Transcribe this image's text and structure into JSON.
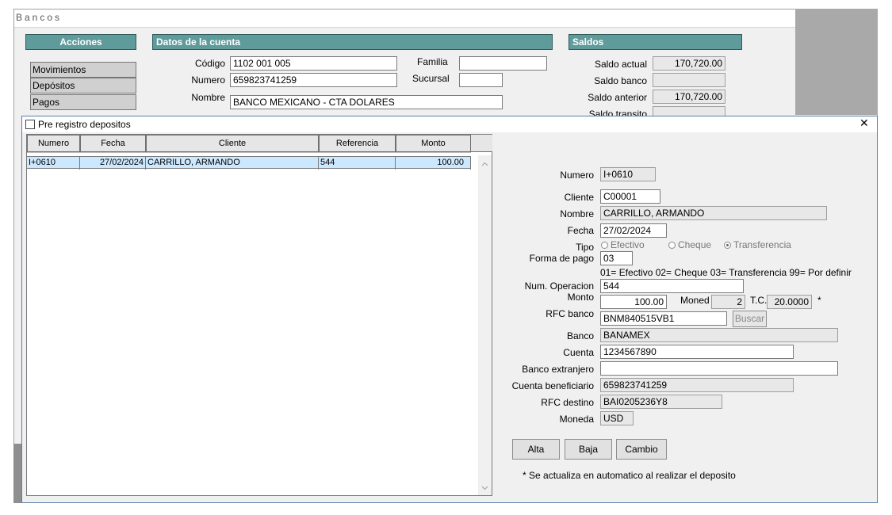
{
  "bg_window": {
    "title": "Bancos",
    "acciones": {
      "header": "Acciones",
      "items": [
        "Movimientos",
        "Depósitos",
        "Pagos"
      ]
    },
    "cuenta": {
      "header": "Datos de la cuenta",
      "codigo_label": "Código",
      "codigo_value": "1102 001 005",
      "numero_label": "Numero",
      "numero_value": "659823741259",
      "nombre_label": "Nombre",
      "nombre_value": "BANCO MEXICANO - CTA DOLARES",
      "familia_label": "Familia",
      "familia_value": "",
      "sucursal_label": "Sucursal",
      "sucursal_value": ""
    },
    "saldos": {
      "header": "Saldos",
      "actual_label": "Saldo actual",
      "actual_value": "170,720.00",
      "banco_label": "Saldo banco",
      "banco_value": "",
      "anterior_label": "Saldo anterior",
      "anterior_value": "170,720.00",
      "transito_label": "Saldo transito"
    }
  },
  "dialog": {
    "title": "Pre registro depositos",
    "close_glyph": "✕",
    "table": {
      "columns": [
        "Numero",
        "Fecha",
        "Cliente",
        "Referencia",
        "Monto"
      ],
      "rows": [
        {
          "numero": "I+0610",
          "fecha": "27/02/2024",
          "cliente": "CARRILLO, ARMANDO",
          "referencia": "544",
          "monto": "100.00"
        }
      ]
    },
    "form": {
      "numero_label": "Numero",
      "numero_value": "I+0610",
      "cliente_label": "Cliente",
      "cliente_value": "C00001",
      "nombre_label": "Nombre",
      "nombre_value": "CARRILLO, ARMANDO",
      "fecha_label": "Fecha",
      "fecha_value": "27/02/2024",
      "tipo_label": "Tipo",
      "tipo_options": [
        "Efectivo",
        "Cheque",
        "Transferencia"
      ],
      "tipo_selected": "Transferencia",
      "forma_pago_label": "Forma de pago",
      "forma_pago_value": "03",
      "forma_pago_hint": "01= Efectivo  02= Cheque  03= Transferencia  99= Por definir",
      "num_operacion_label": "Num. Operacion",
      "num_operacion_value": "544",
      "monto_label": "Monto",
      "monto_value": "100.00",
      "moneda_short_label": "Moned",
      "moneda_short_value": "2",
      "tc_label": "T.C.",
      "tc_value": "20.0000",
      "tc_asterisk": "*",
      "rfc_banco_label": "RFC banco",
      "rfc_banco_value": "BNM840515VB1",
      "buscar_label": "Buscar",
      "banco_label": "Banco",
      "banco_value": "BANAMEX",
      "cuenta_label": "Cuenta",
      "cuenta_value": "1234567890",
      "banco_extranjero_label": "Banco extranjero",
      "banco_extranjero_value": "",
      "cuenta_beneficiario_label": "Cuenta beneficiario",
      "cuenta_beneficiario_value": "659823741259",
      "rfc_destino_label": "RFC destino",
      "rfc_destino_value": "BAI0205236Y8",
      "moneda_label": "Moneda",
      "moneda_value": "USD"
    },
    "buttons": {
      "alta": "Alta",
      "baja": "Baja",
      "cambio": "Cambio"
    },
    "footnote": "* Se actualiza en automatico al realizar el deposito"
  },
  "colors": {
    "header_teal": "#5f9b9b",
    "selected_row": "#cce8ff",
    "gray_panel": "#a9a9a9"
  }
}
